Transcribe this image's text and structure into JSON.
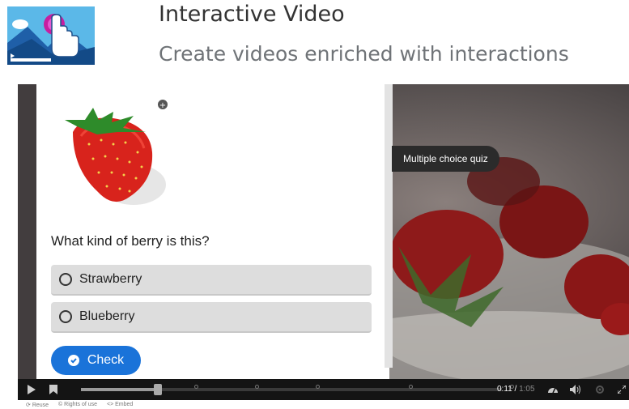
{
  "header": {
    "title": "Interactive Video",
    "subtitle": "Create videos enriched with interactions"
  },
  "quiz": {
    "question": "What kind of berry is this?",
    "options": [
      {
        "label": "Strawberry"
      },
      {
        "label": "Blueberry"
      }
    ],
    "check_label": "Check"
  },
  "overlay": {
    "interaction_label": "Multiple choice quiz"
  },
  "player": {
    "current_time": "0:11",
    "duration": "1:05"
  },
  "footer": {
    "reuse": "Reuse",
    "rights": "Rights of use",
    "embed": "Embed"
  },
  "colors": {
    "accent": "#1a73d9",
    "option_bg": "#dddddd",
    "controls_bg": "#141414"
  },
  "icons": [
    "interactive-video-app-icon",
    "zoom-in-icon",
    "check-circle-icon",
    "play-icon",
    "bookmark-icon",
    "speed-icon",
    "volume-icon",
    "settings-icon",
    "fullscreen-icon",
    "reuse-icon",
    "rights-icon",
    "embed-icon"
  ]
}
